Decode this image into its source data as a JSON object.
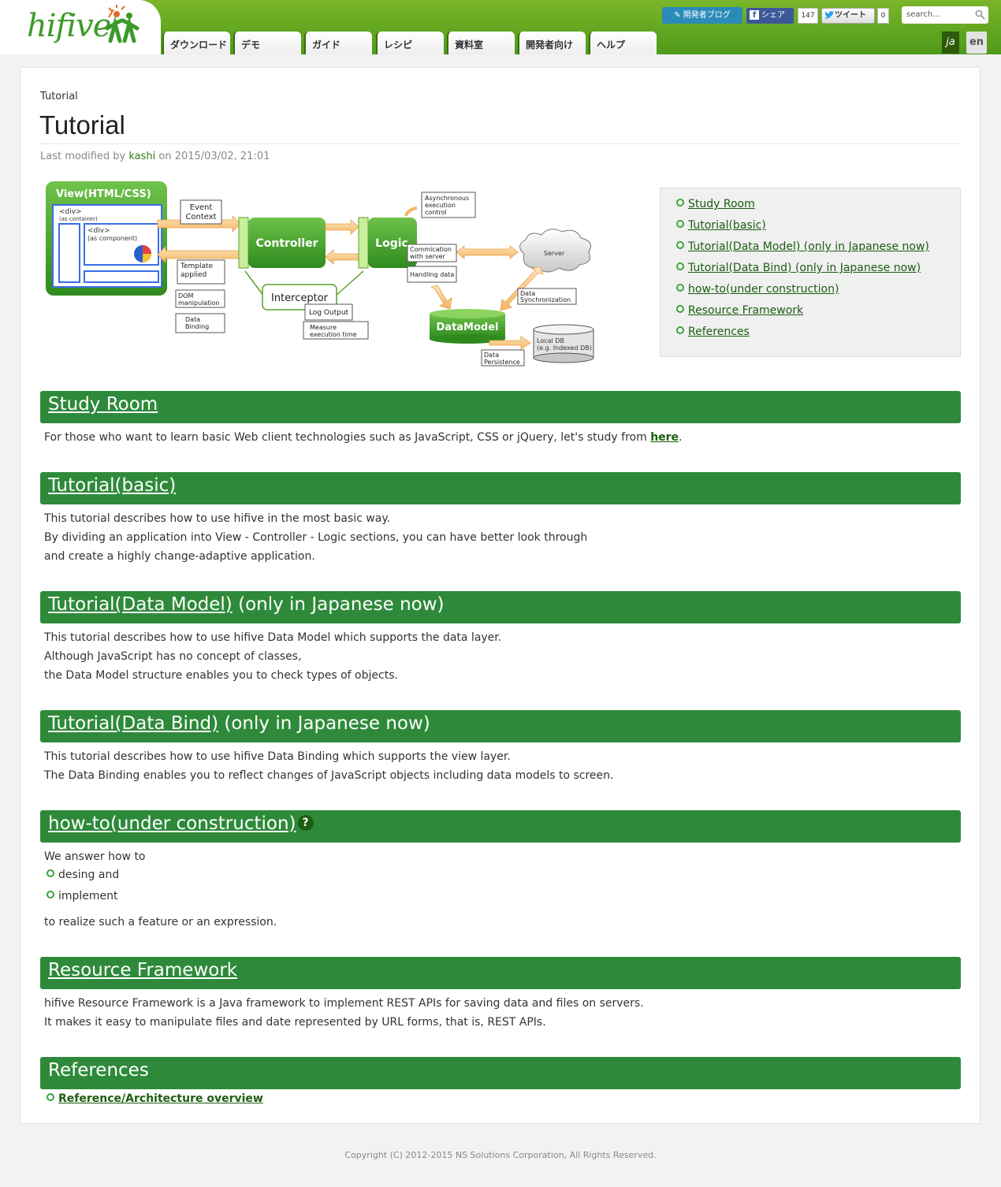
{
  "header": {
    "logo_text": "hifive",
    "nav": [
      "ダウンロード",
      "デモ",
      "ガイド",
      "レシピ",
      "資料室",
      "開発者向け",
      "ヘルプ"
    ],
    "blog_button": "開発者ブログ",
    "share_button": "シェア",
    "share_count": "147",
    "tweet_button": "ツイート",
    "tweet_count": "0",
    "search_placeholder": "search...",
    "lang_ja": "ja",
    "lang_en": "en"
  },
  "page": {
    "breadcrumb": "Tutorial",
    "title": "Tutorial",
    "meta_prefix": "Last modified by",
    "meta_author": "kashi",
    "meta_suffix": "on 2015/03/02, 21:01"
  },
  "diagram": {
    "view_title": "View(HTML/CSS)",
    "div_container": "<div>",
    "as_container": "(as container)",
    "div_component": "<div>",
    "as_component": "(as component)",
    "event_context_1": "Event",
    "event_context_2": "Context",
    "template_1": "Template",
    "template_2": "applied",
    "dom_1": "DOM",
    "dom_2": "manipulation",
    "binding_1": "Data",
    "binding_2": "Binding",
    "controller": "Controller",
    "logic": "Logic",
    "interceptor": "Interceptor",
    "log_output": "Log Output",
    "measure_1": "Measure",
    "measure_2": "execution time",
    "async_1": "Asynchronous",
    "async_2": "execution",
    "async_3": "control",
    "comm_1": "Commication",
    "comm_2": "with server",
    "handling": "Handling data",
    "server": "Server",
    "sync_1": "Data",
    "sync_2": "Synchronization",
    "datamodel": "DataModel",
    "localdb_1": "Local DB",
    "localdb_2": "(e.g. Indexed DB)",
    "persist_1": "Data",
    "persist_2": "Persistence"
  },
  "toc": [
    "Study Room",
    "Tutorial(basic)",
    "Tutorial(Data Model) (only in Japanese now)",
    "Tutorial(Data Bind) (only in Japanese now)",
    "how-to(under construction)",
    "Resource Framework",
    "References"
  ],
  "sections": {
    "study": {
      "title": "Study Room",
      "text": "For those who want to learn basic Web client technologies such as JavaScript, CSS or jQuery, let's study from ",
      "link": "here",
      "end": "."
    },
    "basic": {
      "title": "Tutorial(basic)",
      "lines": [
        "This tutorial describes how to use hifive in the most basic way.",
        "By dividing an application into View - Controller - Logic sections, you can have better look through",
        "and create a highly change-adaptive application."
      ]
    },
    "datamodel": {
      "title": "Tutorial(Data Model)",
      "suffix": " (only in Japanese now)",
      "lines": [
        "This tutorial describes how to use hifive Data Model which supports the data layer.",
        "Although JavaScript has no concept of classes,",
        "the Data Model structure enables you to check types of objects."
      ]
    },
    "databind": {
      "title": "Tutorial(Data Bind)",
      "suffix": " (only in Japanese now)",
      "lines": [
        "This tutorial describes how to use hifive Data Binding which supports the view layer.",
        "The Data Binding enables you to reflect changes of JavaScript objects including data models to screen."
      ]
    },
    "howto": {
      "title": "how-to(under construction)",
      "help": "?",
      "intro": "We answer how to",
      "items": [
        "desing and",
        "implement"
      ],
      "outro": "to realize such a feature or an expression."
    },
    "resource": {
      "title": "Resource Framework",
      "lines": [
        "hifive Resource Framework is a Java framework to implement REST APIs for saving data and files on servers.",
        "It makes it easy to manipulate files and date represented by URL forms, that is, REST APIs."
      ]
    },
    "references": {
      "title": "References",
      "link": "Reference/Architecture overview"
    }
  },
  "footer": "Copyright (C) 2012-2015 NS Solutions Corporation, All Rights Reserved.",
  "colors": {
    "header_green": "#5fa61f",
    "section_green": "#2e8a3a",
    "link_green": "#1b5e10"
  }
}
